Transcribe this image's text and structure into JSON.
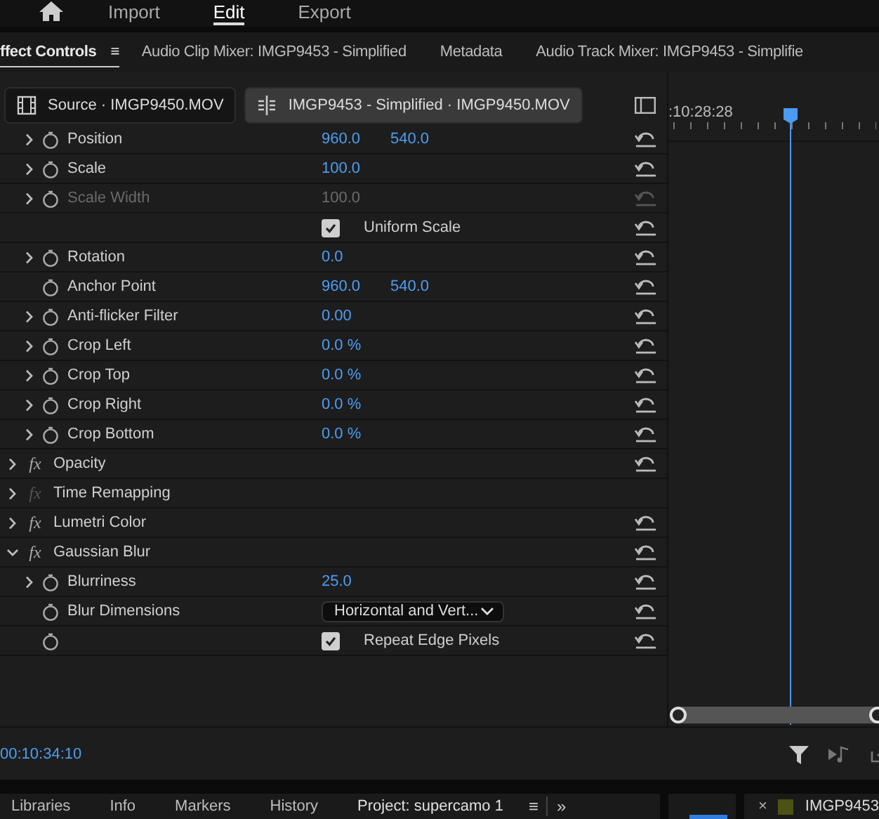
{
  "top_nav": [
    {
      "label": "Import",
      "selected": false
    },
    {
      "label": "Edit",
      "selected": true
    },
    {
      "label": "Export",
      "selected": false
    }
  ],
  "panel_tabs": [
    {
      "label": "ffect Controls",
      "selected": true,
      "menu": "≡"
    },
    {
      "label": "Audio Clip Mixer: IMGP9453 - Simplified",
      "selected": false
    },
    {
      "label": "Metadata",
      "selected": false
    },
    {
      "label": "Audio Track Mixer: IMGP9453 - Simplifie",
      "selected": false
    }
  ],
  "clips": [
    {
      "kind": "source",
      "label": "Source · IMGP9450.MOV",
      "selected": false
    },
    {
      "kind": "sequence",
      "label": "IMGP9453 - Simplified · IMGP9450.MOV",
      "selected": true
    }
  ],
  "timeline": {
    "timecode": ":10:28:28"
  },
  "motion_params": [
    {
      "kind": "param",
      "label": "Position",
      "values": [
        "960.0",
        "540.0"
      ],
      "chevron": true,
      "disabled": false
    },
    {
      "kind": "param",
      "label": "Scale",
      "values": [
        "100.0"
      ],
      "chevron": true,
      "disabled": false
    },
    {
      "kind": "param",
      "label": "Scale Width",
      "values": [
        "100.0"
      ],
      "chevron": true,
      "disabled": true
    },
    {
      "kind": "checkbox",
      "label": "Uniform Scale",
      "checked": true,
      "stopwatch": false
    },
    {
      "kind": "param",
      "label": "Rotation",
      "values": [
        "0.0"
      ],
      "chevron": true,
      "disabled": false
    },
    {
      "kind": "param",
      "label": "Anchor Point",
      "values": [
        "960.0",
        "540.0"
      ],
      "chevron": false,
      "disabled": false
    },
    {
      "kind": "param",
      "label": "Anti-flicker Filter",
      "values": [
        "0.00"
      ],
      "chevron": true,
      "disabled": false
    },
    {
      "kind": "param",
      "label": "Crop Left",
      "values": [
        "0.0 %"
      ],
      "chevron": true,
      "disabled": false
    },
    {
      "kind": "param",
      "label": "Crop Top",
      "values": [
        "0.0 %"
      ],
      "chevron": true,
      "disabled": false
    },
    {
      "kind": "param",
      "label": "Crop Right",
      "values": [
        "0.0 %"
      ],
      "chevron": true,
      "disabled": false
    },
    {
      "kind": "param",
      "label": "Crop Bottom",
      "values": [
        "0.0 %"
      ],
      "chevron": true,
      "disabled": false
    }
  ],
  "effects": [
    {
      "label": "Opacity",
      "fx": "fx",
      "fx_enabled": true,
      "expanded": false,
      "reset": true
    },
    {
      "label": "Time Remapping",
      "fx": "fx",
      "fx_enabled": false,
      "expanded": false,
      "reset": false
    },
    {
      "label": "Lumetri Color",
      "fx": "fx",
      "fx_enabled": true,
      "expanded": false,
      "reset": true
    },
    {
      "label": "Gaussian Blur",
      "fx": "fx",
      "fx_enabled": true,
      "expanded": true,
      "reset": true,
      "children": [
        {
          "kind": "param",
          "label": "Blurriness",
          "values": [
            "25.0"
          ],
          "chevron": true,
          "disabled": false
        },
        {
          "kind": "dropdown",
          "label": "Blur Dimensions",
          "value": "Horizontal and Vert..."
        },
        {
          "kind": "checkbox",
          "label": "Repeat Edge Pixels",
          "checked": true,
          "stopwatch": true
        }
      ]
    }
  ],
  "current_time": "00:10:34:10",
  "bottom_tabs": [
    {
      "label": "Libraries",
      "selected": false
    },
    {
      "label": "Info",
      "selected": false
    },
    {
      "label": "Markers",
      "selected": false
    },
    {
      "label": "History",
      "selected": false
    },
    {
      "label": "Project: supercamo  1",
      "selected": true
    }
  ],
  "bottom_menu": "≡",
  "bottom_more": "»",
  "bin_close": "×",
  "bin_item": {
    "label": "IMGP9453",
    "color": "#4b5213"
  }
}
